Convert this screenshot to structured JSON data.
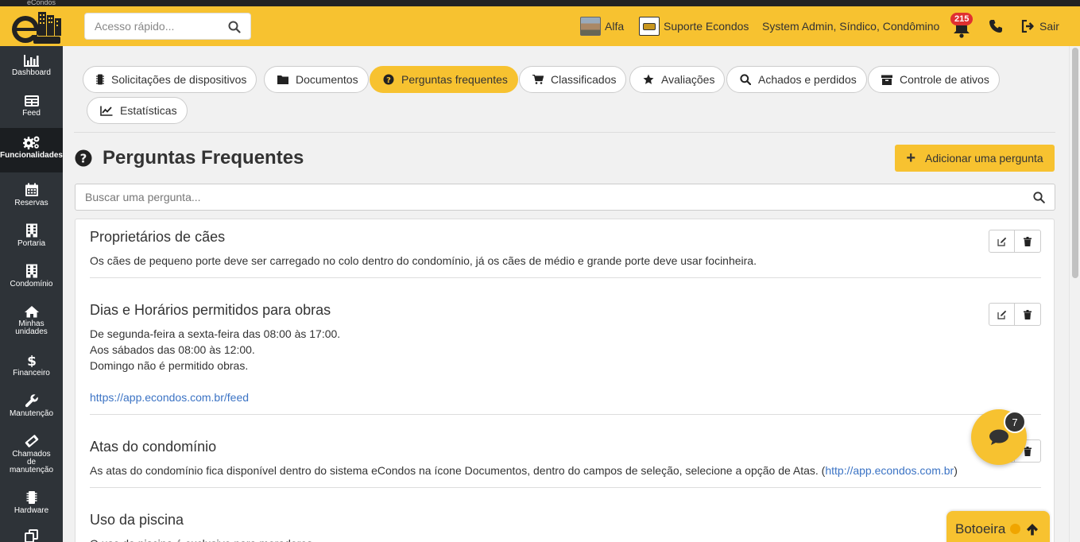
{
  "window": {
    "title": "eCondos"
  },
  "header": {
    "quick_search_placeholder": "Acesso rápido...",
    "condo_name": "Alfa",
    "support_label": "Suporte Econdos",
    "user_roles": "System Admin, Síndico, Condômino",
    "notifications_count": "215",
    "logout_label": "Sair"
  },
  "sidebar": {
    "items": [
      {
        "label": "Dashboard",
        "icon": "chart-bar-icon"
      },
      {
        "label": "Feed",
        "icon": "newspaper-icon"
      },
      {
        "label": "Funcionalidades",
        "icon": "cogs-icon"
      },
      {
        "label": "Reservas",
        "icon": "calendar-icon"
      },
      {
        "label": "Portaria",
        "icon": "building-icon"
      },
      {
        "label": "Condomínio",
        "icon": "building-icon"
      },
      {
        "label": "Minhas unidades",
        "icon": "home-icon"
      },
      {
        "label": "Financeiro",
        "icon": "dollar-icon"
      },
      {
        "label": "Manutenção",
        "icon": "wrench-icon"
      },
      {
        "label": "Chamados de manutenção",
        "icon": "ticket-icon"
      },
      {
        "label": "Hardware",
        "icon": "microchip-icon"
      }
    ]
  },
  "tabs": [
    {
      "label": "Solicitações de dispositivos",
      "icon": "microchip-icon"
    },
    {
      "label": "Documentos",
      "icon": "folder-icon"
    },
    {
      "label": "Perguntas frequentes",
      "icon": "question-circle-icon",
      "active": true
    },
    {
      "label": "Classificados",
      "icon": "cart-icon"
    },
    {
      "label": "Avaliações",
      "icon": "star-icon"
    },
    {
      "label": "Achados e perdidos",
      "icon": "search-icon"
    },
    {
      "label": "Controle de ativos",
      "icon": "archive-icon"
    },
    {
      "label": "Estatísticas",
      "icon": "line-chart-icon"
    }
  ],
  "page": {
    "title": "Perguntas Frequentes",
    "add_button_label": "Adicionar uma pergunta",
    "search_placeholder": "Buscar uma pergunta..."
  },
  "faqs": [
    {
      "question": "Proprietários de cães",
      "answer_lines": [
        "Os cães de pequeno porte deve ser carregado no colo dentro do condomínio, já os cães de médio e grande porte deve usar focinheira."
      ]
    },
    {
      "question": "Dias e Horários permitidos para obras",
      "answer_lines": [
        "De segunda-feira a sexta-feira das 08:00 às 17:00.",
        "Aos sábados das 08:00 às 12:00.",
        "Domingo não é permitido obras."
      ],
      "link": "https://app.econdos.com.br/feed"
    },
    {
      "question": "Atas do condomínio",
      "answer_text": "As atas do condomínio fica disponível dentro do sistema eCondos na ícone Documentos, dentro do campos de seleção, selecione a opção de Atas. (",
      "answer_link": "http://app.econdos.com.br",
      "answer_suffix": ")"
    },
    {
      "question": "Uso da piscina",
      "answer_lines": [
        "O uso da piscina é exclusivo para moradores."
      ]
    }
  ],
  "chat": {
    "badge_count": "7"
  },
  "botoeira": {
    "label": "Botoeira"
  },
  "colors": {
    "brand_yellow": "#f7c230",
    "sidebar_dark": "#2e3338",
    "link_blue": "#3b73c4",
    "badge_red": "#e03030"
  }
}
